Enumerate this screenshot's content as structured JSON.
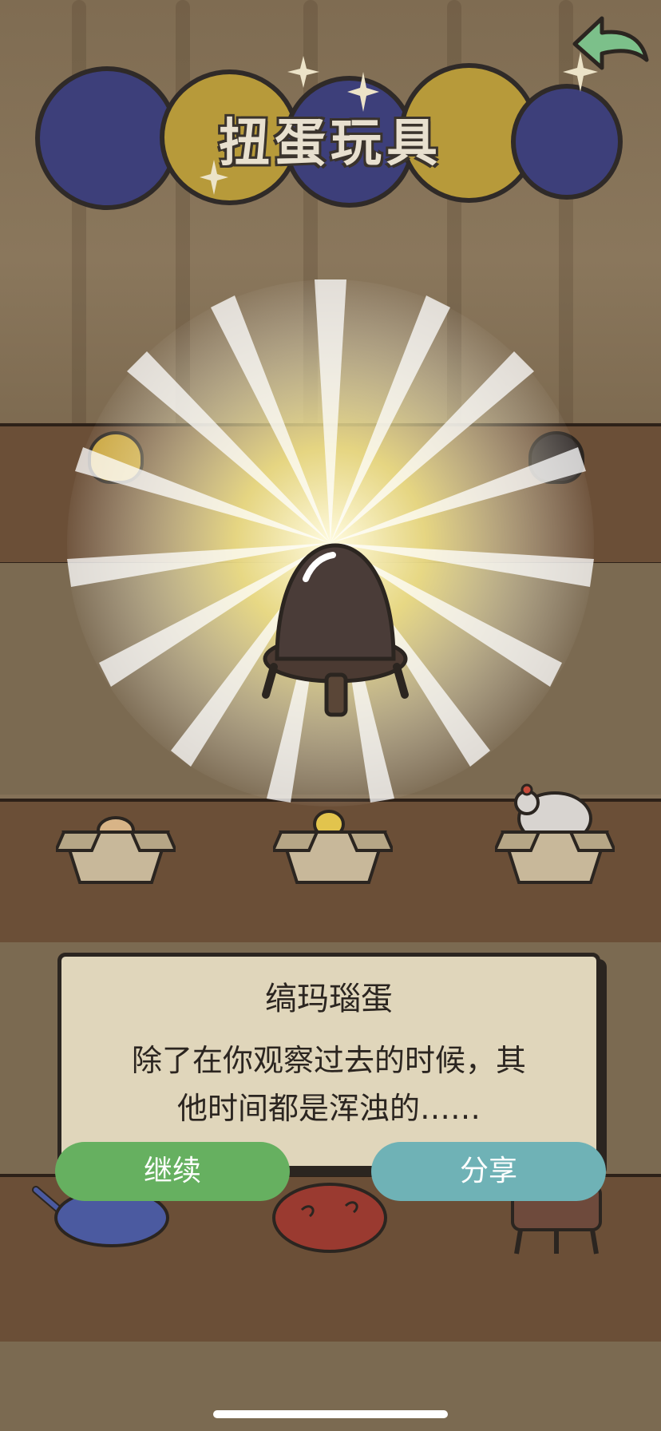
{
  "header": {
    "title": "扭蛋玩具"
  },
  "dialog": {
    "title": "缟玛瑙蛋",
    "description_line1": "除了在你观察过去的时候，其",
    "description_line2": "他时间都是浑浊的……"
  },
  "buttons": {
    "continue_label": "继续",
    "share_label": "分享"
  },
  "icons": {
    "back": "back-arrow-icon",
    "sparkle": "sparkle-icon",
    "featured_item": "onyx-egg-icon"
  },
  "colors": {
    "continue": "#66b060",
    "share": "#6fb2b6",
    "dialog_bg": "#e0d6bb",
    "egg_blue": "#3d3f7a",
    "egg_yellow": "#b79a3a"
  }
}
